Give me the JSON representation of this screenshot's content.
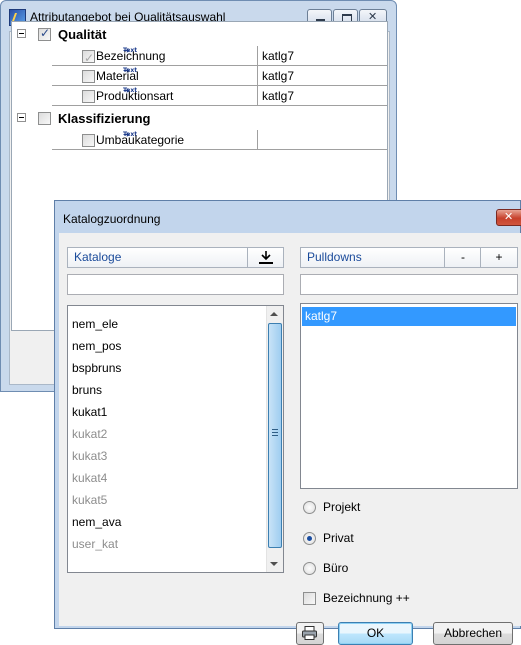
{
  "back_window": {
    "title": "Attributangebot bei Qualitätsauswahl",
    "tree": {
      "groups": [
        {
          "label": "Qualität",
          "checked": true,
          "rows": [
            {
              "label": "Bezeichnung",
              "value": "katlg7",
              "checked": true,
              "disabled": true
            },
            {
              "label": "Material",
              "value": "katlg7",
              "checked": false,
              "disabled": false
            },
            {
              "label": "Produktionsart",
              "value": "katlg7",
              "checked": false,
              "disabled": false
            }
          ]
        },
        {
          "label": "Klassifizierung",
          "checked": false,
          "rows": [
            {
              "label": "Umbaukategorie",
              "value": "",
              "checked": false,
              "disabled": false
            }
          ]
        }
      ],
      "row_icon": "text-arrow-icon",
      "row_icon_text": "Text"
    }
  },
  "dialog": {
    "title": "Katalogzuordnung",
    "catalogs_header": "Kataloge",
    "catalogs_header_icon": "download-icon",
    "catalogs_filter": "",
    "catalogs": [
      {
        "name": "nem_ele",
        "disabled": false
      },
      {
        "name": "nem_pos",
        "disabled": false
      },
      {
        "name": "bspbruns",
        "disabled": false
      },
      {
        "name": "bruns",
        "disabled": false
      },
      {
        "name": "kukat1",
        "disabled": false
      },
      {
        "name": "kukat2",
        "disabled": true
      },
      {
        "name": "kukat3",
        "disabled": true
      },
      {
        "name": "kukat4",
        "disabled": true
      },
      {
        "name": "kukat5",
        "disabled": true
      },
      {
        "name": "nem_ava",
        "disabled": false
      },
      {
        "name": "user_kat",
        "disabled": true
      }
    ],
    "pulldowns_header": "Pulldowns",
    "pulldowns_minus": "-",
    "pulldowns_plus": "+",
    "pulldowns_filter": "",
    "pulldowns": [
      "katlg7"
    ],
    "pulldowns_selected": "katlg7",
    "options": [
      {
        "label": "Projekt",
        "selected": false
      },
      {
        "label": "Privat",
        "selected": true
      },
      {
        "label": "Büro",
        "selected": false
      }
    ],
    "bezeichnung_checkbox": {
      "label": "Bezeichnung ++",
      "checked": false
    },
    "print_icon": "printer-icon",
    "ok_label": "OK",
    "cancel_label": "Abbrechen"
  }
}
